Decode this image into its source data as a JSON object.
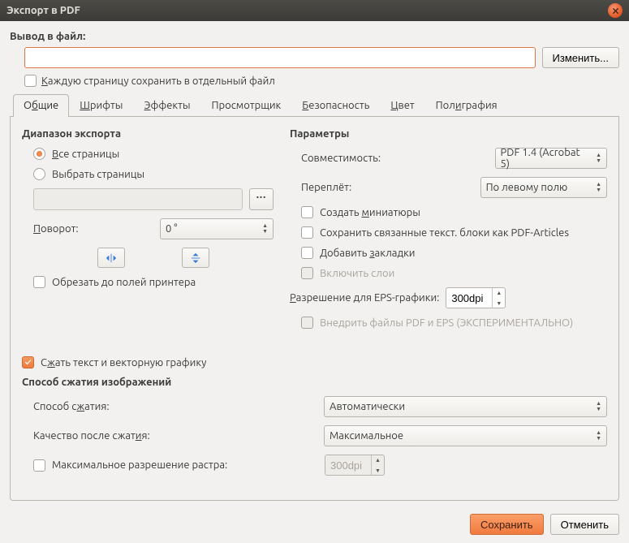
{
  "window": {
    "title": "Экспорт в PDF"
  },
  "output": {
    "label": "Вывод в файл:",
    "value": "",
    "change_btn": "Изменить...",
    "save_each_page": "Каждую страницу сохранить в отдельный файл"
  },
  "tabs": [
    {
      "label_pre": "О",
      "label_u": "б",
      "label_post": "щие"
    },
    {
      "label_pre": "",
      "label_u": "Ш",
      "label_post": "рифты"
    },
    {
      "label_pre": "",
      "label_u": "Э",
      "label_post": "ффекты"
    },
    {
      "label_pre": "Просмотрщик",
      "label_u": "",
      "label_post": ""
    },
    {
      "label_pre": "",
      "label_u": "Б",
      "label_post": "езопасность"
    },
    {
      "label_pre": "",
      "label_u": "Ц",
      "label_post": "вет"
    },
    {
      "label_pre": "Пол",
      "label_u": "и",
      "label_post": "графия"
    }
  ],
  "range": {
    "title": "Диапазон экспорта",
    "all_pages": "Все страницы",
    "choose_pages": "Выбрать страницы",
    "rotation_label": "Поворот:",
    "rotation_value": "0 °",
    "crop_label": "Обрезать до полей принтера"
  },
  "params": {
    "title": "Параметры",
    "compat_label": "Совместимость:",
    "compat_value": "PDF 1.4 (Acrobat 5)",
    "binding_label": "Переплёт:",
    "binding_value": "По левому полю",
    "thumbnails": "Создать миниатюры",
    "text_frames": "Сохранить связанные текст. блоки как PDF-Articles",
    "bookmarks": "Добавить закладки",
    "layers": "Включить слои",
    "eps_res_label": "Разрешение для EPS-графики:",
    "eps_res_value": "300dpi",
    "embed_pdf_eps": "Внедрить файлы PDF и EPS (ЭКСПЕРИМЕНТАЛЬНО)"
  },
  "compress": {
    "text_vector": "Сжать текст и векторную графику",
    "title": "Способ сжатия изображений",
    "method_label": "Способ сжатия:",
    "method_value": "Автоматически",
    "quality_label": "Качество после сжатия:",
    "quality_value": "Максимальное",
    "max_res_label": "Максимальное разрешение растра:",
    "max_res_value": "300dpi"
  },
  "buttons": {
    "save": "Сохранить",
    "cancel": "Отменить"
  }
}
